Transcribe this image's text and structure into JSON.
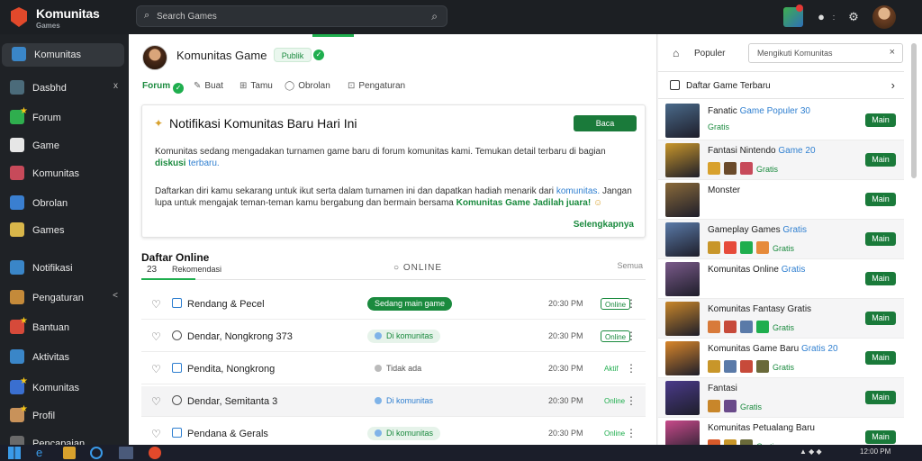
{
  "app": {
    "brand": "Komunitas",
    "brand_sub": "Games"
  },
  "search": {
    "placeholder": "Search Games"
  },
  "sidebar": {
    "items": [
      {
        "label": "Komunitas",
        "color": "#3a86c8",
        "active": true
      },
      {
        "label": "Dasbhd",
        "color": "#4b6b7a",
        "count": "x"
      },
      {
        "label": "Forum",
        "color": "#2fae4e",
        "star": true
      },
      {
        "label": "Game",
        "color": "#e6e6e6"
      },
      {
        "label": "Komunitas",
        "color": "#c74a5a"
      },
      {
        "label": "Obrolan",
        "color": "#3a7fd0"
      },
      {
        "label": "Games",
        "color": "#d8b64a"
      },
      {
        "label": "Notifikasi",
        "color": "#3a86c8"
      },
      {
        "label": "Pengaturan",
        "color": "#c48a3a",
        "count": "<"
      },
      {
        "label": "Bantuan",
        "color": "#d64a3a",
        "star": true
      },
      {
        "label": "Aktivitas",
        "color": "#3a86c8"
      },
      {
        "label": "Komunitas",
        "color": "#3a6fd0",
        "star": true
      },
      {
        "label": "Profil",
        "color": "#c8925a",
        "star": true
      },
      {
        "label": "Pencapaian",
        "color": "#6a6a6a"
      }
    ]
  },
  "header": {
    "title": "Komunitas Game",
    "pill": "Publik"
  },
  "subtabs": [
    {
      "label": "Forum",
      "active": true
    },
    {
      "label": "Buat"
    },
    {
      "label": "Tamu"
    },
    {
      "label": "Obrolan"
    },
    {
      "label": "Pengaturan"
    }
  ],
  "card": {
    "title": "Notifikasi Komunitas Baru Hari Ini",
    "button": "Baca Selengkapnya",
    "para1_a": "Komunitas sedang mengadakan turnamen game baru di forum komunitas kami. Temukan detail terbaru di bagian",
    "para1_g": "diskusi",
    "para1_b": "terbaru.",
    "para2_a": "Daftarkan diri kamu sekarang untuk ikut serta dalam turnamen ini dan dapatkan hadiah menarik dari",
    "para2_blue": "komunitas.",
    "para2_c": "Jangan lupa untuk mengajak teman-teman kamu bergabung dan bermain bersama",
    "para2_g": "Komunitas Game",
    "para2_g2": "Jadilah juara!",
    "link": "Selengkapnya"
  },
  "section": {
    "title": "Daftar Online",
    "sub1": "23",
    "sub2": "Rekomendasi",
    "mid": "ONLINE",
    "right": "Semua"
  },
  "rows": [
    {
      "name": "Rendang & Pecel",
      "tag": "Sedang main game",
      "tag_style": "solid",
      "time": "20:30 PM",
      "status": "Online",
      "status_style": "box",
      "icon": "square"
    },
    {
      "name": "Dendar, Nongkrong 373",
      "tag": "Di komunitas",
      "tag_style": "soft",
      "dot": "#7fb3e8",
      "time": "20:30 PM",
      "status": "Online",
      "status_style": "box",
      "icon": "circle"
    },
    {
      "name": "Pendita, Nongkrong",
      "tag": "Tidak ada",
      "tag_style": "plain",
      "dot": "#bbbbbb",
      "time": "20:30 PM",
      "status": "Aktif",
      "status_style": "txt",
      "icon": "square"
    },
    {
      "name": "Dendar, Semitanta 3",
      "tag": "Di komunitas",
      "tag_style": "blue",
      "dot": "#7fb3e8",
      "time": "20:30 PM",
      "status": "Online",
      "status_style": "txt",
      "icon": "circle",
      "alt": true
    },
    {
      "name": "Pendana & Gerals",
      "tag": "Di komunitas",
      "tag_style": "soft",
      "dot": "#7fb3e8",
      "time": "20:30 PM",
      "status": "Online",
      "status_style": "txt",
      "icon": "square"
    }
  ],
  "right_panel": {
    "label": "Populer",
    "input": "Mengikuti Komunitas",
    "section": "Daftar Game Terbaru",
    "games": [
      {
        "name": "Fanatic",
        "name_c": "Game Populer 30",
        "sub": "Gratis",
        "btn": "Main",
        "thumb": "#4a6a8a"
      },
      {
        "name": "Fantasi Nintendo",
        "name_c": "Game 20",
        "sub": "Gratis",
        "btn": "Main",
        "thumb": "#c8962a",
        "minis": [
          "#d8a12d",
          "#6a4a2a",
          "#c74a5a"
        ]
      },
      {
        "name": "Monster",
        "sub": "",
        "btn": "Main",
        "thumb": "#8a6a3a"
      },
      {
        "name": "Gameplay Games",
        "name_c": "Gratis",
        "sub": "Gratis",
        "btn": "Main",
        "thumb": "#5a7aa8",
        "minis": [
          "#c8962a",
          "#e64a3a",
          "#1fae4e",
          "#e68a3a"
        ]
      },
      {
        "name": "Komunitas Online",
        "name_c": "Gratis",
        "sub": "",
        "btn": "Main",
        "thumb": "#7a5a8a"
      },
      {
        "name": "Komunitas Fantasy Gratis",
        "sub": "Gratis",
        "btn": "Main",
        "thumb": "#c8862a",
        "minis": [
          "#d87a3a",
          "#c74a3a",
          "#5a7aa8",
          "#1fae4e"
        ]
      },
      {
        "name": "Komunitas Game Baru",
        "name_c": "Gratis 20",
        "sub": "Gratis",
        "btn": "Main",
        "thumb": "#d8862a",
        "minis": [
          "#c8962a",
          "#5a7aa8",
          "#c74a3a",
          "#6a6a3a"
        ]
      },
      {
        "name": "Fantasi",
        "name_c": "",
        "sub": "Gratis",
        "btn": "Main",
        "thumb": "#4a3a8a",
        "minis": [
          "#c8862a",
          "#6a4a8a"
        ]
      },
      {
        "name": "Komunitas Petualang Baru",
        "sub": "Gratis",
        "btn": "Main",
        "thumb": "#c84a8a",
        "minis": [
          "#d85a2a",
          "#c8962a",
          "#6a6a3a"
        ]
      }
    ]
  },
  "taskbar": {
    "time": "12:00 PM"
  }
}
